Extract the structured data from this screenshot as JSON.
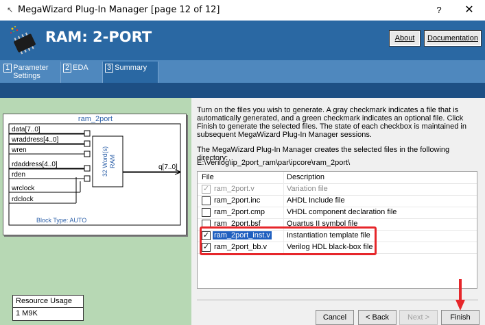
{
  "window": {
    "title": "MegaWizard Plug-In Manager [page 12 of 12]",
    "help_label": "?",
    "close_label": "✕"
  },
  "header": {
    "title": "RAM: 2-PORT",
    "about_label": "About",
    "documentation_label": "Documentation"
  },
  "tabs": [
    {
      "num": "1",
      "label": "Parameter Settings"
    },
    {
      "num": "2",
      "label": "EDA"
    },
    {
      "num": "3",
      "label": "Summary"
    }
  ],
  "diagram": {
    "module_name": "ram_2port",
    "inputs": [
      "data[7..0]",
      "wraddress[4..0]",
      "wren",
      "rdaddress[4..0]",
      "rden",
      "wrclock",
      "rdclock"
    ],
    "output": "q[7..0]",
    "block_label": "32 Word(s) RAM",
    "block_type": "Block Type: AUTO"
  },
  "resource_usage": {
    "title": "Resource Usage",
    "value": "1 M9K"
  },
  "content": {
    "intro": "Turn on the files you wish to generate. A gray checkmark indicates a file that is automatically generated, and a green checkmark indicates an optional file. Click Finish to generate the selected files. The state of each checkbox is maintained in subsequent MegaWizard Plug-In Manager sessions.",
    "dir_text": "The MegaWizard Plug-In Manager creates the selected files in the following directory:",
    "path": "E:\\Verilog\\ip_2port_ram\\par\\ipcore\\ram_2port\\"
  },
  "file_table": {
    "headers": [
      "File",
      "Description"
    ],
    "rows": [
      {
        "file": "ram_2port.v",
        "description": "Variation file",
        "checked": true,
        "auto": true
      },
      {
        "file": "ram_2port.inc",
        "description": "AHDL Include file",
        "checked": false,
        "auto": false
      },
      {
        "file": "ram_2port.cmp",
        "description": "VHDL component declaration file",
        "checked": false,
        "auto": false
      },
      {
        "file": "ram_2port.bsf",
        "description": "Quartus II symbol file",
        "checked": false,
        "auto": false
      },
      {
        "file": "ram_2port_inst.v",
        "description": "Instantiation template file",
        "checked": true,
        "auto": false
      },
      {
        "file": "ram_2port_bb.v",
        "description": "Verilog HDL black-box file",
        "checked": true,
        "auto": false
      }
    ]
  },
  "buttons": {
    "cancel": "Cancel",
    "back": "< Back",
    "next": "Next >",
    "finish": "Finish"
  },
  "colors": {
    "header_blue": "#2a68a3",
    "tab_blue": "#4f88be",
    "panel_green": "#b7d8b4",
    "highlight_red": "#e6262a",
    "selection_blue": "#1f5fbf"
  }
}
